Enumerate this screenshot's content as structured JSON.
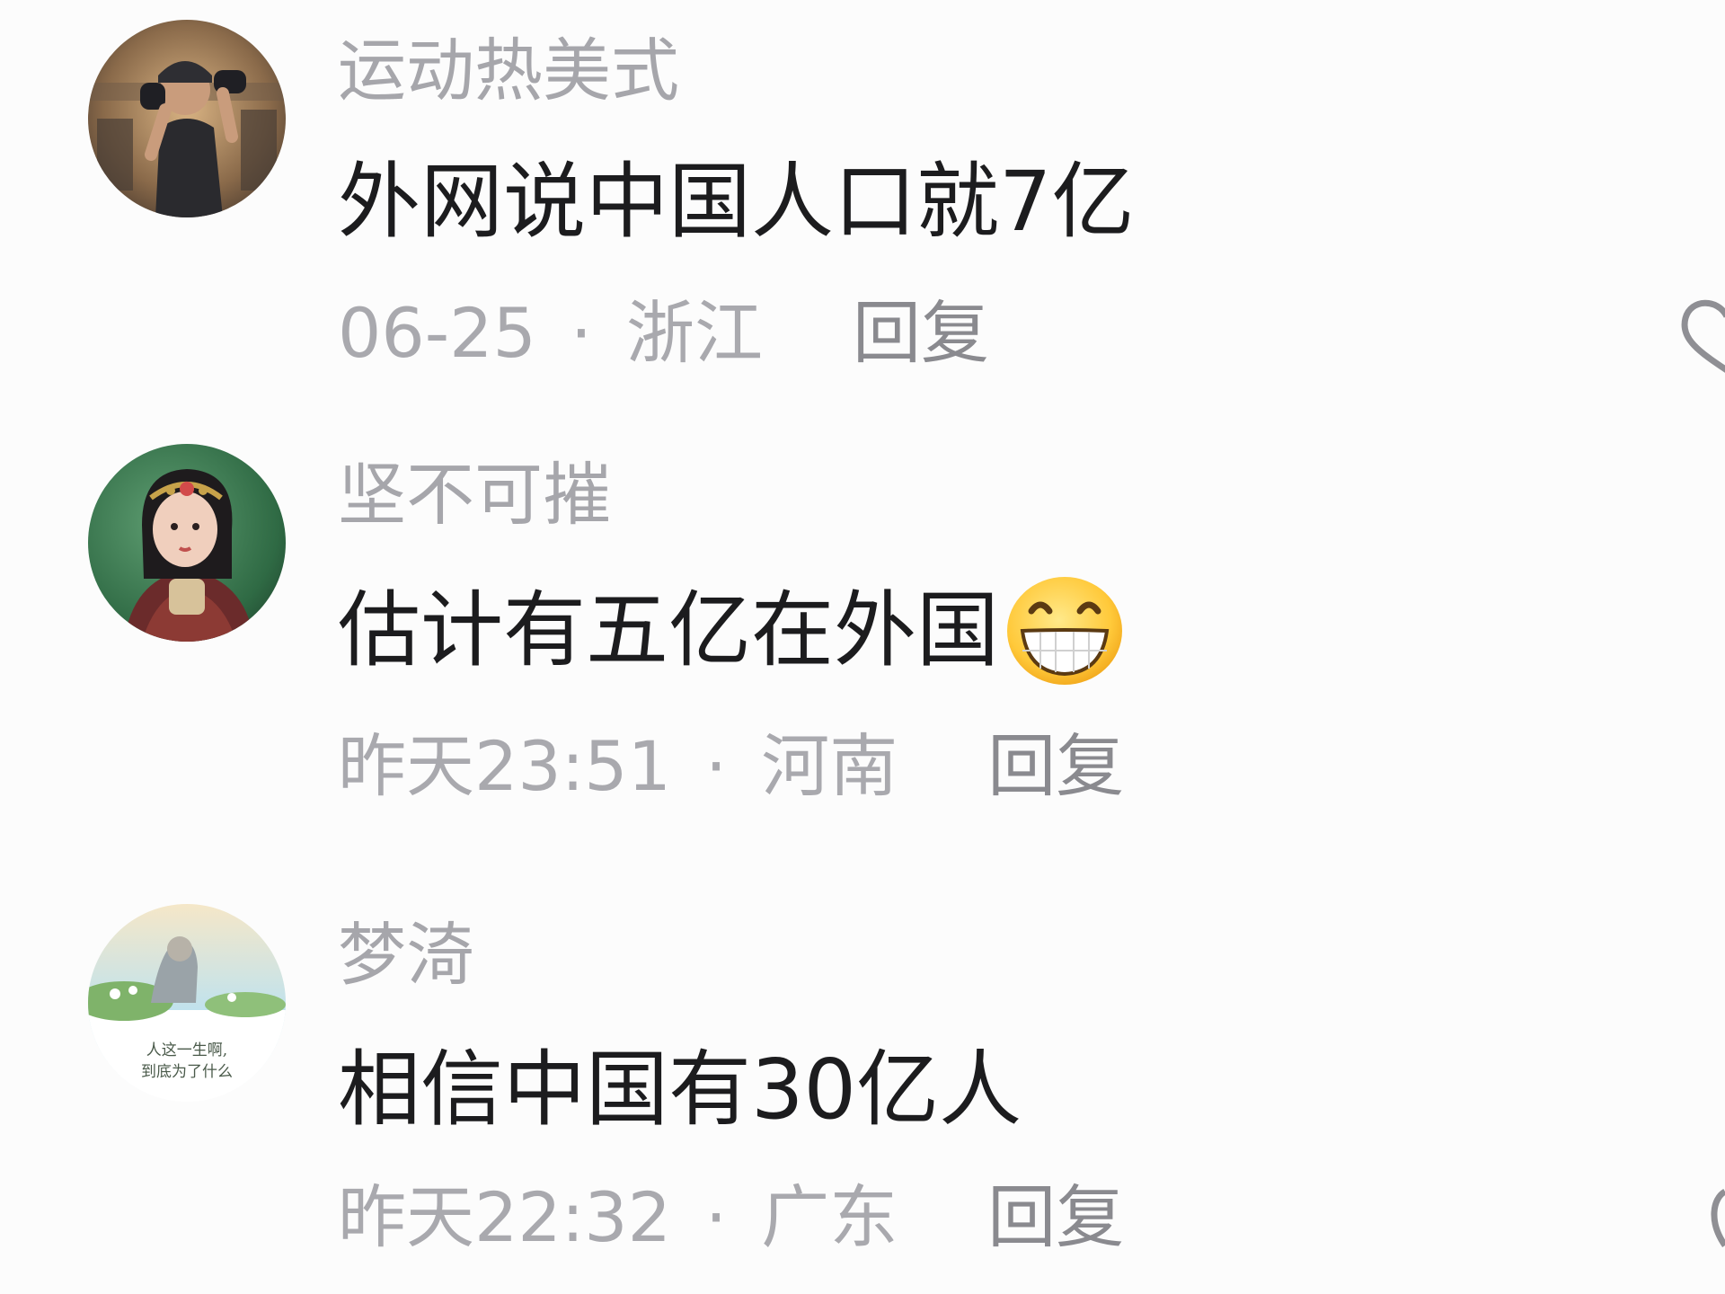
{
  "comments": [
    {
      "username": "运动热美式",
      "text": "外网说中国人口就7亿",
      "date": "06-25",
      "separator": "·",
      "location": "浙江",
      "reply_label": "回复",
      "avatar_icon": "avatar-boxer-girl"
    },
    {
      "username": "坚不可摧",
      "text": "估计有五亿在外国",
      "emoji": "grinning-face-emoji",
      "date": "昨天23:51",
      "separator": "·",
      "location": "河南",
      "reply_label": "回复",
      "avatar_icon": "avatar-ethnic-girl"
    },
    {
      "username": "梦渏",
      "text": "相信中国有30亿人",
      "date": "昨天22:32",
      "separator": "·",
      "location": "广东",
      "reply_label": "回复",
      "avatar_icon": "avatar-lotus-landscape",
      "avatar_caption": "人这一生啊, 到底为了什么"
    }
  ],
  "colors": {
    "username": "#a6a6ab",
    "text": "#1c1c1e",
    "meta": "#a9a9ae",
    "reply": "#8a8a8f",
    "background": "#fcfcfc"
  }
}
